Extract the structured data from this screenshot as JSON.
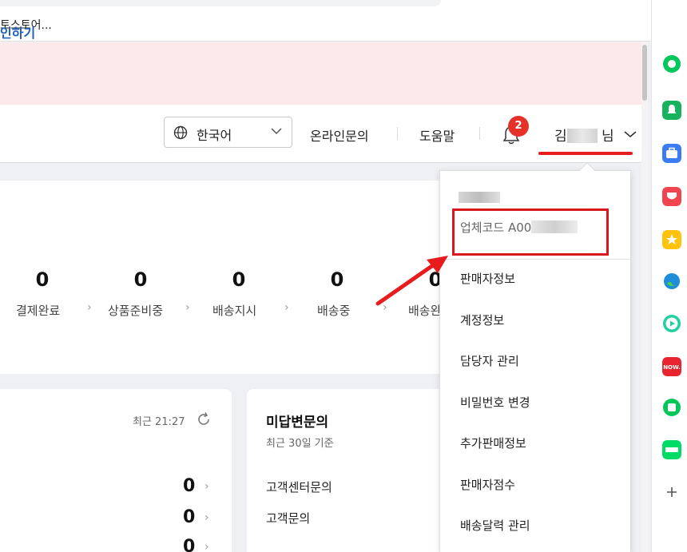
{
  "bookmark": {
    "label": "토스토어..."
  },
  "banner": {
    "link_text": "인하기"
  },
  "header": {
    "language": "한국어",
    "online_inquiry": "온라인문의",
    "help": "도움말",
    "notification_count": "2",
    "user_prefix": "김",
    "user_suffix": "님"
  },
  "order_status": [
    {
      "count": "0",
      "label": "결제완료"
    },
    {
      "count": "0",
      "label": "상품준비중"
    },
    {
      "count": "0",
      "label": "배송지시"
    },
    {
      "count": "0",
      "label": "배송중"
    },
    {
      "count": "0",
      "label": "배송완"
    }
  ],
  "left_card": {
    "recent": "최근 21:27",
    "counts": [
      "0",
      "0",
      "0"
    ]
  },
  "right_card": {
    "title": "미답변문의",
    "subtitle": "최근 30일 기준",
    "items": [
      "고객센터문의",
      "고객문의"
    ]
  },
  "dropdown": {
    "code_prefix": "업체코드 A00",
    "items": [
      "판매자정보",
      "계정정보",
      "담당자 관리",
      "비밀번호 변경",
      "추가판매정보",
      "판매자점수",
      "배송달력 관리"
    ]
  },
  "colors": {
    "highlight_red": "#e81c1c",
    "banner_bg": "#fce9e9",
    "link_blue": "#1f5fbf",
    "badge_red": "#e4322b"
  }
}
